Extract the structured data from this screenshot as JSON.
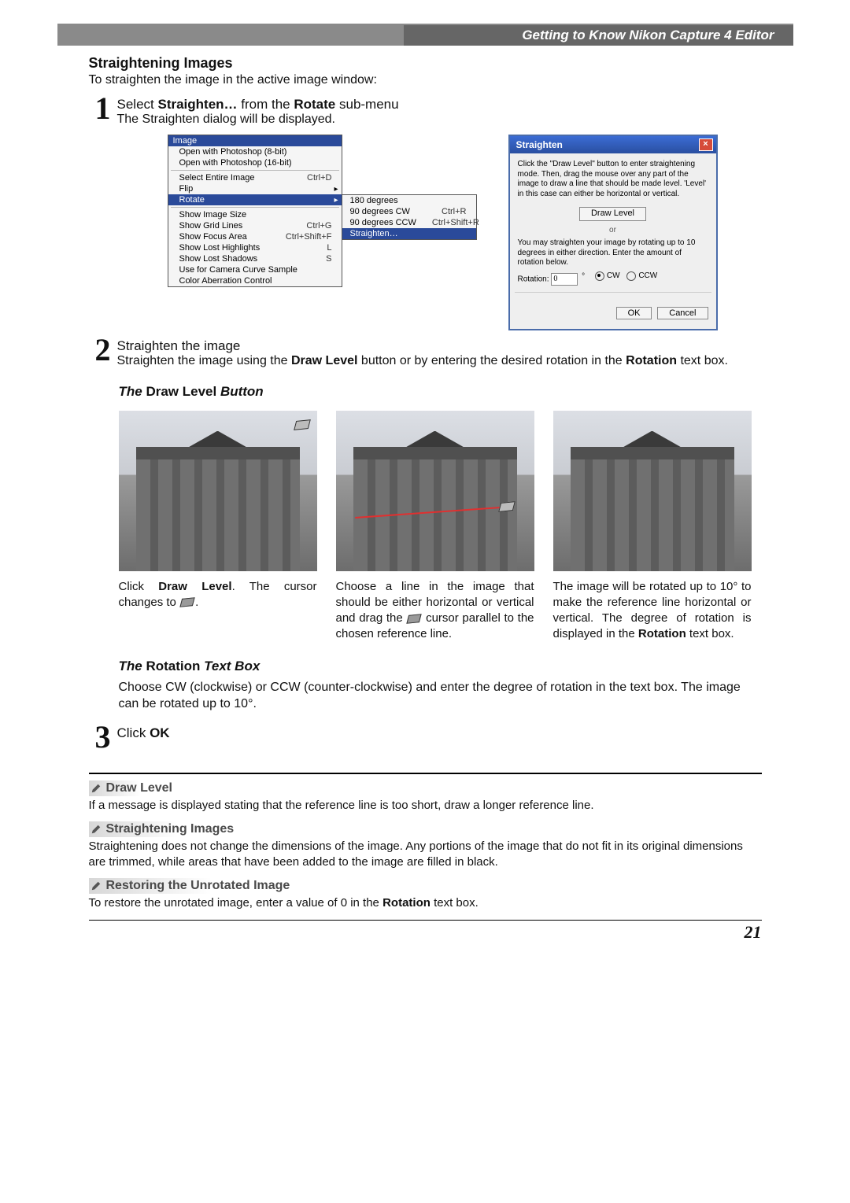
{
  "chapter_header": "Getting to Know Nikon Capture 4 Editor",
  "section": {
    "title": "Straightening Images",
    "intro": "To straighten the image in the active image window:"
  },
  "steps": {
    "n1": "1",
    "s1_title_pre": "Select ",
    "s1_title_bold1": "Straighten…",
    "s1_title_mid": " from the ",
    "s1_title_bold2": "Rotate",
    "s1_title_post": " sub-menu",
    "s1_desc": "The Straighten dialog will be displayed.",
    "n2": "2",
    "s2_title": "Straighten the image",
    "s2_desc_a": "Straighten the image using the ",
    "s2_desc_b": "Draw Level",
    "s2_desc_c": " button or by entering the desired rotation in the ",
    "s2_desc_d": "Rotation",
    "s2_desc_e": " text box.",
    "n3": "3",
    "s3_title_pre": "Click ",
    "s3_title_bold": "OK"
  },
  "menu": {
    "title": "Image",
    "open8": "Open with Photoshop (8-bit)",
    "open16": "Open with Photoshop (16-bit)",
    "select_all": "Select Entire Image",
    "select_all_key": "Ctrl+D",
    "flip": "Flip",
    "rotate": "Rotate",
    "show_size": "Show Image Size",
    "show_grid": "Show Grid Lines",
    "show_grid_key": "Ctrl+G",
    "show_focus": "Show Focus Area",
    "show_focus_key": "Ctrl+Shift+F",
    "lost_hi": "Show Lost Highlights",
    "lost_hi_key": "L",
    "lost_sh": "Show Lost Shadows",
    "lost_sh_key": "S",
    "cam_curve": "Use for Camera Curve Sample",
    "aberration": "Color Aberration Control"
  },
  "submenu": {
    "d180": "180 degrees",
    "cw": "90 degrees CW",
    "cw_key": "Ctrl+R",
    "ccw": "90 degrees CCW",
    "ccw_key": "Ctrl+Shift+R",
    "straighten": "Straighten…"
  },
  "dialog": {
    "title": "Straighten",
    "msg1": "Click the \"Draw Level\" button to enter straightening mode.  Then, drag the mouse over any part of the image to draw a line that should be made level.  'Level' in this case can either be horizontal or vertical.",
    "draw_level_btn": "Draw Level",
    "or": "or",
    "msg2": "You may straighten your image by rotating up to 10 degrees in either direction.  Enter the amount of rotation below.",
    "rotation_label": "Rotation:",
    "rotation_value": "0",
    "deg": "°",
    "cw": "CW",
    "ccw": "CCW",
    "ok": "OK",
    "cancel": "Cancel"
  },
  "drawlevel_heading_pre": "The ",
  "drawlevel_heading_bold": "Draw Level",
  "drawlevel_heading_post": " Button",
  "captions": {
    "c1a": "Click ",
    "c1b": "Draw Level",
    "c1c": ".  The cursor changes to ",
    "c1d": ".",
    "c2a": "Choose a line in the image that should be either horizontal or vertical and drag the ",
    "c2b": " cursor parallel to the chosen reference line.",
    "c3": "The image will be rotated up to 10° to make the reference line horizontal or vertical.  The degree of rotation is displayed in the ",
    "c3b": "Rotation",
    "c3c": " text box."
  },
  "rotation_heading_pre": "The ",
  "rotation_heading_bold": "Rotation",
  "rotation_heading_post": " Text Box",
  "rotation_para": "Choose CW (clockwise) or CCW (counter-clockwise) and enter the degree of rotation in the text box.  The image can be rotated up to 10°.",
  "notes": {
    "n1_title": "Draw Level",
    "n1_body": "If a message is displayed stating that the reference line is too short, draw a longer reference line.",
    "n2_title": "Straightening Images",
    "n2_body": "Straightening does not change the dimensions of the image.  Any portions of the image that do not fit in its original dimensions are trimmed, while areas that have been added to the image are filled in black.",
    "n3_title": "Restoring the Unrotated Image",
    "n3_body_a": "To restore the unrotated image, enter a value of 0 in the ",
    "n3_body_b": "Rotation",
    "n3_body_c": " text box."
  },
  "page_number": "21"
}
